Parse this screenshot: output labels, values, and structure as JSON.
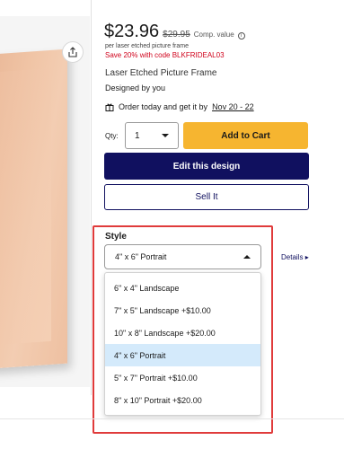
{
  "product": {
    "price": "$23.96",
    "original_price": "$29.95",
    "comp_value_label": "Comp. value",
    "per_unit_note": "per laser etched picture frame",
    "promo": "Save 20% with code BLKFRIDEAL03",
    "name": "Laser Etched Picture Frame",
    "designer": "Designed by you"
  },
  "shipping": {
    "text": "Order today and get it by",
    "date": "Nov 20 - 22"
  },
  "purchase": {
    "qty_label": "Qty:",
    "qty_value": "1",
    "add_to_cart": "Add to Cart",
    "edit_design": "Edit this design",
    "sell_it": "Sell It"
  },
  "style": {
    "label": "Style",
    "selected": "4\" x 6\" Portrait",
    "details_link": "Details",
    "options": [
      {
        "label": "6\" x 4\" Landscape"
      },
      {
        "label": "7\" x 5\" Landscape   +$10.00"
      },
      {
        "label": "10\" x 8\" Landscape   +$20.00"
      },
      {
        "label": "4\" x 6\" Portrait",
        "selected": true
      },
      {
        "label": "5\" x 7\" Portrait   +$10.00"
      },
      {
        "label": "8\" x 10\" Portrait   +$20.00"
      }
    ]
  },
  "icons": [
    "share-icon",
    "info-icon",
    "gift-icon",
    "chevron-down-icon",
    "chevron-up-icon",
    "chevron-right-icon"
  ],
  "colors": {
    "accent_yellow": "#f6b530",
    "navy": "#10105f",
    "promo_red": "#d0021b",
    "selected_option": "#d4eafb",
    "highlight_red": "#e03b3b"
  }
}
